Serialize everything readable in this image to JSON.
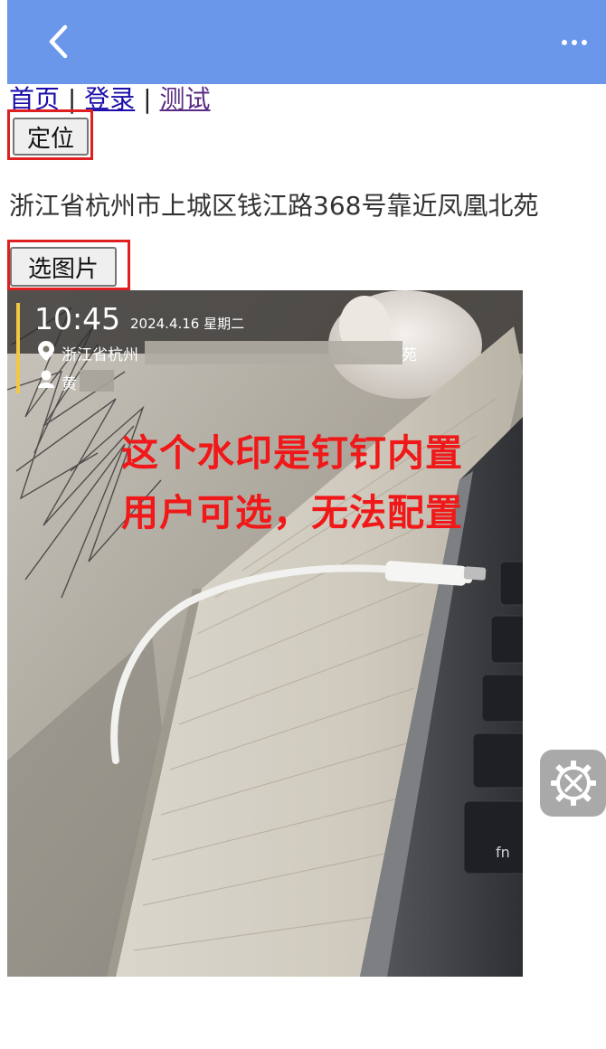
{
  "nav": {
    "back_icon": "chevron-left-icon",
    "more_icon": "more-dots-icon",
    "bar_color": "#6b97ea"
  },
  "links": {
    "home": "首页",
    "sep1": " | ",
    "login": "登录",
    "sep2": " | ",
    "test": "测试"
  },
  "locate_button": "定位",
  "address": "浙江省杭州市上城区钱江路368号靠近凤凰北苑",
  "pick_image_button": "选图片",
  "photo": {
    "watermark": {
      "time": "10:45",
      "date": "2024.4.16 星期二",
      "location_prefix": "浙江省杭州",
      "location_suffix": "苑",
      "user_prefix": "黄"
    },
    "annotation_line1": "这个水印是钉钉内置",
    "annotation_line2": "用户可选，无法配置",
    "keys": {
      "fn": "fn"
    }
  },
  "float_button_icon": "settings-tools-icon",
  "highlight_color": "#e02020"
}
